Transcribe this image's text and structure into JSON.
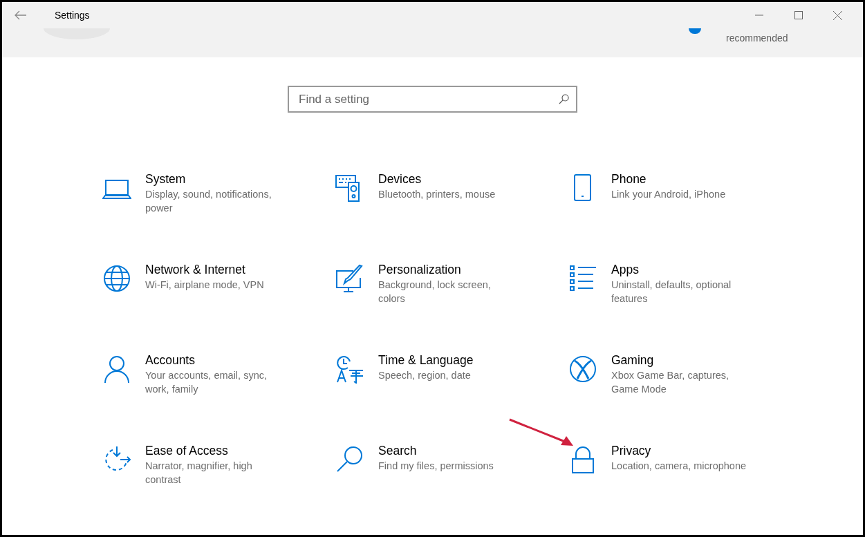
{
  "window": {
    "title": "Settings"
  },
  "header": {
    "status_text": "recommended"
  },
  "search": {
    "placeholder": "Find a setting"
  },
  "categories": [
    {
      "title": "System",
      "description": "Display, sound, notifications, power"
    },
    {
      "title": "Devices",
      "description": "Bluetooth, printers, mouse"
    },
    {
      "title": "Phone",
      "description": "Link your Android, iPhone"
    },
    {
      "title": "Network & Internet",
      "description": "Wi-Fi, airplane mode, VPN"
    },
    {
      "title": "Personalization",
      "description": "Background, lock screen, colors"
    },
    {
      "title": "Apps",
      "description": "Uninstall, defaults, optional features"
    },
    {
      "title": "Accounts",
      "description": "Your accounts, email, sync, work, family"
    },
    {
      "title": "Time & Language",
      "description": "Speech, region, date"
    },
    {
      "title": "Gaming",
      "description": "Xbox Game Bar, captures, Game Mode"
    },
    {
      "title": "Ease of Access",
      "description": "Narrator, magnifier, high contrast"
    },
    {
      "title": "Search",
      "description": "Find my files, permissions"
    },
    {
      "title": "Privacy",
      "description": "Location, camera, microphone"
    }
  ]
}
